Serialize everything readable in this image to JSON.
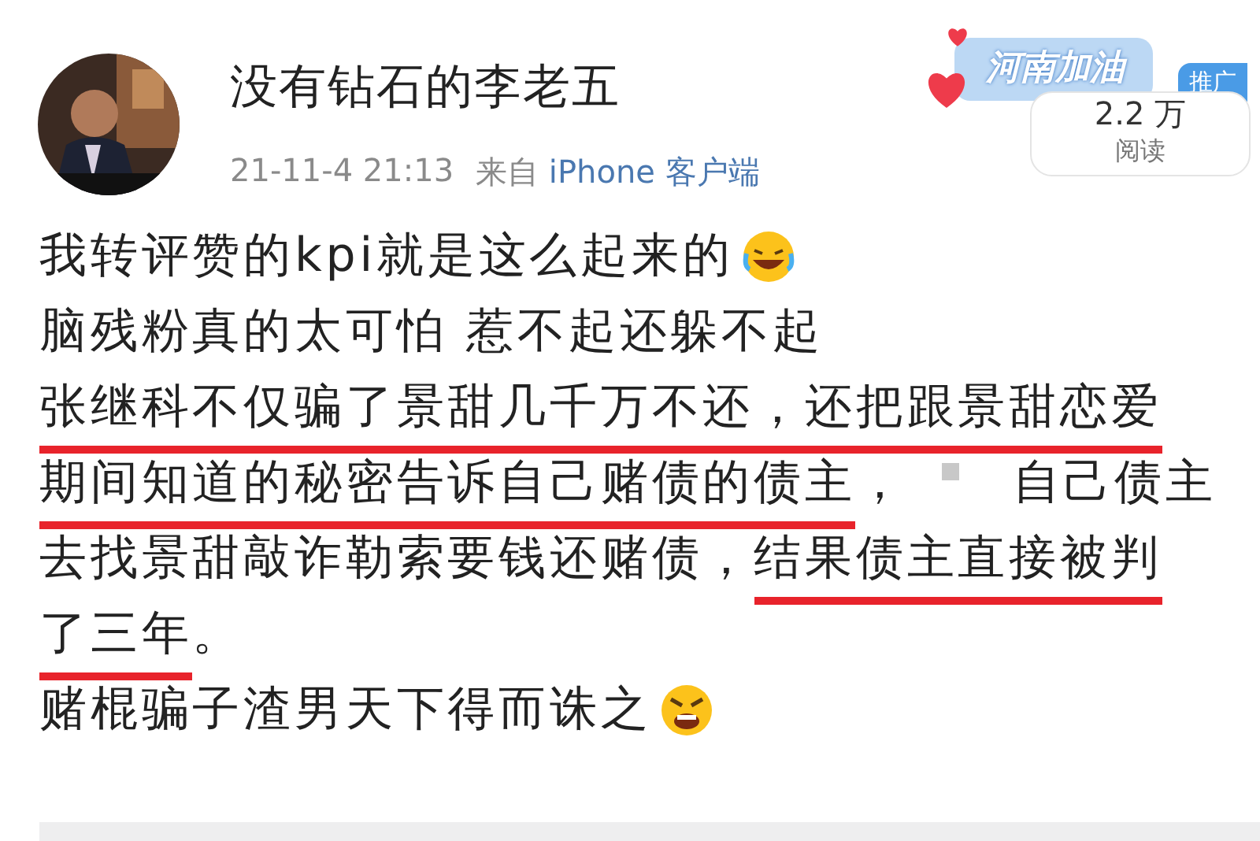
{
  "post": {
    "author": "没有钻石的李老五",
    "time": "21-11-4 21:13",
    "source_prefix": "来自",
    "source": "iPhone 客户端"
  },
  "badge": {
    "sticker": "河南加油",
    "promo": "推广",
    "reads": "2.2 万",
    "reads_label": "阅读"
  },
  "lines": [
    {
      "segments": [
        {
          "kind": "text",
          "text": "我转评赞的kpi就是这么起来的",
          "underlined": false
        },
        {
          "kind": "laugh"
        }
      ]
    },
    {
      "segments": [
        {
          "kind": "text",
          "text": "脑残粉真的太可怕 惹不起还躲不起",
          "underlined": false
        }
      ]
    },
    {
      "segments": [
        {
          "kind": "text",
          "text": "张继科不仅骗了景甜几千万不还，还把跟景甜恋爱",
          "underlined": true
        }
      ]
    },
    {
      "segments": [
        {
          "kind": "text",
          "text": "期间知道的秘密告诉自己赌债的债主",
          "underlined": true
        },
        {
          "kind": "text",
          "text": "，",
          "underlined": false
        },
        {
          "kind": "square"
        },
        {
          "kind": "text",
          "text": "自己债主",
          "underlined": false
        }
      ]
    },
    {
      "segments": [
        {
          "kind": "text",
          "text": "去找景甜敲诈勒索要钱还赌债，",
          "underlined": false
        },
        {
          "kind": "text",
          "text": "结果债主直接被判",
          "underlined": true
        }
      ]
    },
    {
      "segments": [
        {
          "kind": "text",
          "text": "了三年",
          "underlined": true
        },
        {
          "kind": "text",
          "text": "。",
          "underlined": false
        }
      ]
    },
    {
      "segments": [
        {
          "kind": "text",
          "text": "赌棍骗子渣男天下得而诛之",
          "underlined": false
        },
        {
          "kind": "angry"
        }
      ]
    }
  ]
}
